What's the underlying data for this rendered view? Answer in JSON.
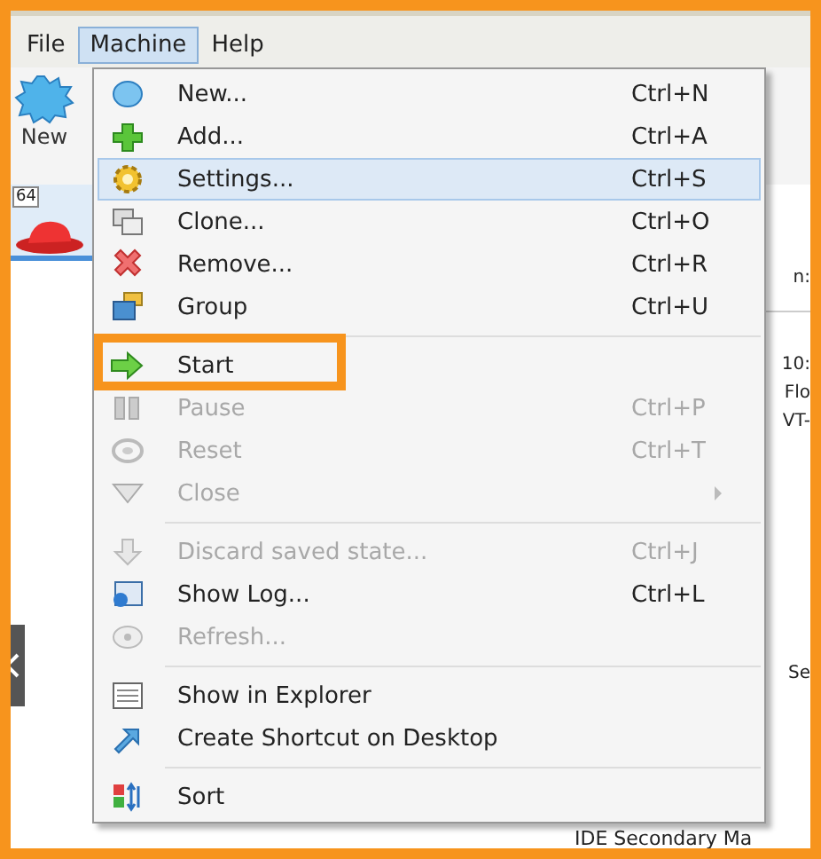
{
  "menubar": [
    {
      "label": "File",
      "selected": false
    },
    {
      "label": "Machine",
      "selected": true
    },
    {
      "label": "Help",
      "selected": false
    }
  ],
  "toolbar": {
    "new_button": "New"
  },
  "vm_list": [
    {
      "badge": "64",
      "selected": true
    }
  ],
  "details_fragments": [
    "n:",
    "10:",
    "Flo",
    "VT-",
    "Se"
  ],
  "details_bottom": "IDE Secondary Ma",
  "menu": [
    {
      "kind": "item",
      "label": "New...",
      "shortcut": "Ctrl+N",
      "disabled": false,
      "hovered": false,
      "outlined": false
    },
    {
      "kind": "item",
      "label": "Add...",
      "shortcut": "Ctrl+A",
      "disabled": false,
      "hovered": false,
      "outlined": false
    },
    {
      "kind": "item",
      "label": "Settings...",
      "shortcut": "Ctrl+S",
      "disabled": false,
      "hovered": true,
      "outlined": false
    },
    {
      "kind": "item",
      "label": "Clone...",
      "shortcut": "Ctrl+O",
      "disabled": false,
      "hovered": false,
      "outlined": false
    },
    {
      "kind": "item",
      "label": "Remove...",
      "shortcut": "Ctrl+R",
      "disabled": false,
      "hovered": false,
      "outlined": false
    },
    {
      "kind": "item",
      "label": "Group",
      "shortcut": "Ctrl+U",
      "disabled": false,
      "hovered": false,
      "outlined": false
    },
    {
      "kind": "separator"
    },
    {
      "kind": "item",
      "label": "Start",
      "disabled": false,
      "hovered": false,
      "outlined": true
    },
    {
      "kind": "item",
      "label": "Pause",
      "shortcut": "Ctrl+P",
      "disabled": true,
      "hovered": false,
      "outlined": false
    },
    {
      "kind": "item",
      "label": "Reset",
      "shortcut": "Ctrl+T",
      "disabled": true,
      "hovered": false,
      "outlined": false
    },
    {
      "kind": "submenu",
      "label": "Close",
      "disabled": true,
      "hovered": false,
      "outlined": false
    },
    {
      "kind": "separator"
    },
    {
      "kind": "item",
      "label": "Discard saved state...",
      "shortcut": "Ctrl+J",
      "disabled": true,
      "hovered": false,
      "outlined": false
    },
    {
      "kind": "item",
      "label": "Show Log...",
      "shortcut": "Ctrl+L",
      "disabled": false,
      "hovered": false,
      "outlined": false
    },
    {
      "kind": "item",
      "label": "Refresh...",
      "disabled": true,
      "hovered": false,
      "outlined": false
    },
    {
      "kind": "separator"
    },
    {
      "kind": "item",
      "label": "Show in Explorer",
      "disabled": false,
      "hovered": false,
      "outlined": false
    },
    {
      "kind": "item",
      "label": "Create Shortcut on Desktop",
      "disabled": false,
      "hovered": false,
      "outlined": false
    },
    {
      "kind": "separator"
    },
    {
      "kind": "item",
      "label": "Sort",
      "disabled": false,
      "hovered": false,
      "outlined": false
    }
  ]
}
